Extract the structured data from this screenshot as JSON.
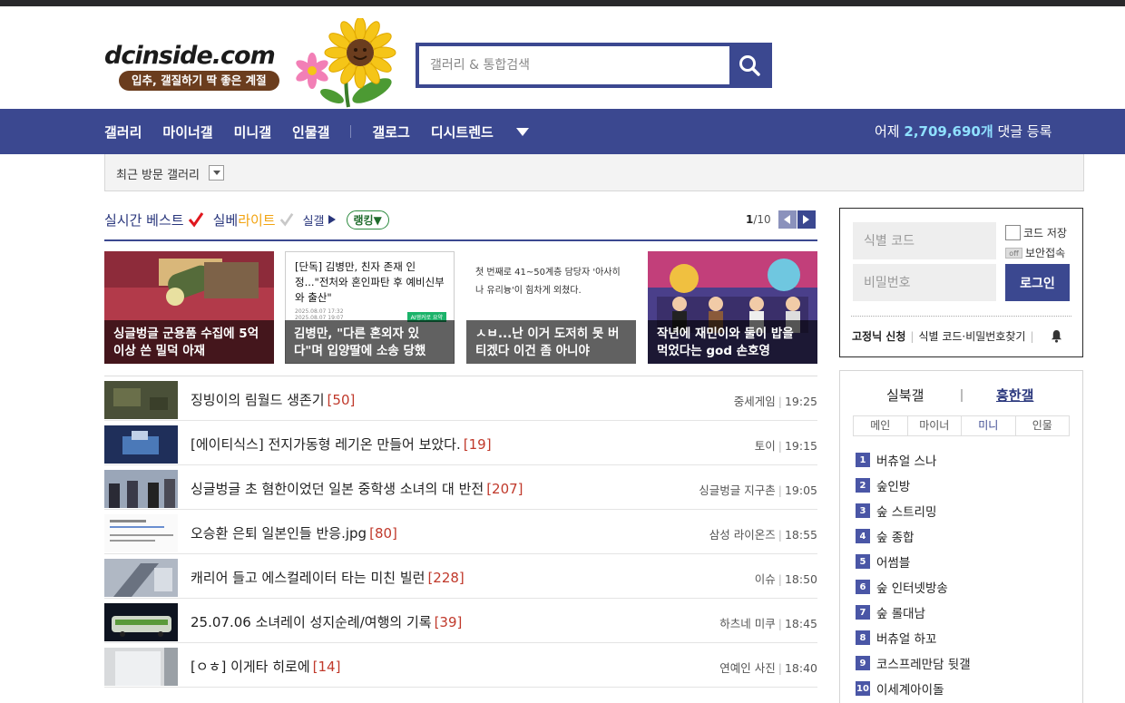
{
  "header": {
    "logo_text": "dcinside.com",
    "slogan": "입추, 갤질하기 딱 좋은 계절",
    "search_placeholder": "갤러리 & 통합검색"
  },
  "nav": {
    "items": [
      "갤러리",
      "마이너갤",
      "미니갤",
      "인물갤",
      "갤로그",
      "디시트렌드"
    ],
    "stat_prefix": "어제",
    "stat_number": "2,709,690개",
    "stat_suffix": "댓글 등록"
  },
  "recent": {
    "label": "최근 방문 갤러리"
  },
  "best": {
    "tab_realtime": "실시간 베스트",
    "tab_lite_prefix": "실베",
    "tab_lite_suffix": "라이트",
    "tab_silgal": "실갤",
    "ranking": "랭킹",
    "page_current": "1",
    "page_total": "/10"
  },
  "cards": [
    {
      "caption": "싱글벙글 군용품 수집에 5억 이상 쓴 밀덕 아재"
    },
    {
      "caption": "김병만, \"다른 혼외자 있다\"며 입양딸에 소송 당했",
      "inner_text": "[단독] 김병만, 친자 존재 인정...\"전처와 혼인파탄 후 예비신부와 출산\"",
      "inner_meta1": "2025.08.07 17:32",
      "inner_meta2": "2025.08.07 19:07",
      "inner_badge": "AI앵커로 요약"
    },
    {
      "caption": "ㅅㅂ...난 이거 도저히 못 버티겠다 이건 좀 아니야",
      "inner_text": "첫 번째로 41~50계층 담당자 '아사히나 유리늉'이 힘차게 외쳤다."
    },
    {
      "caption": "작년에 재민이와 둘이 밥을 먹었다는 god 손호영"
    }
  ],
  "posts": [
    {
      "title": "징빙이의 림월드 생존기",
      "count": "[50]",
      "gallery": "중세게임",
      "time": "19:25"
    },
    {
      "title": "[에이티식스] 전지가동형 레기온 만들어 보았다.",
      "count": "[19]",
      "gallery": "토이",
      "time": "19:15"
    },
    {
      "title": "싱글벙글 초 혐한이었던 일본 중학생 소녀의 대 반전",
      "count": "[207]",
      "gallery": "싱글벙글 지구촌",
      "time": "19:05"
    },
    {
      "title": "오승환 은퇴 일본인들 반응.jpg",
      "count": "[80]",
      "gallery": "삼성 라이온즈",
      "time": "18:55"
    },
    {
      "title": "캐리어 들고 에스컬레이터 타는 미친 빌런",
      "count": "[228]",
      "gallery": "이슈",
      "time": "18:50"
    },
    {
      "title": "25.07.06 소녀레이 성지순례/여행의 기록",
      "count": "[39]",
      "gallery": "하츠네 미쿠",
      "time": "18:45"
    },
    {
      "title": "[ㅇㅎ] 이게타 히로에",
      "count": "[14]",
      "gallery": "연예인 사진",
      "time": "18:40"
    }
  ],
  "login": {
    "id_placeholder": "식별 코드",
    "pw_placeholder": "비밀번호",
    "save_code": "코드 저장",
    "secure_off": "off",
    "secure": "보안접속",
    "login_button": "로그인",
    "signup": "고정닉 신청",
    "find": "식별 코드·비밀번호찾기"
  },
  "gallery_rank": {
    "tab1": "실북갤",
    "tab2": "흥한갤",
    "subtabs": [
      "메인",
      "마이너",
      "미니",
      "인물"
    ],
    "active_subtab": "미니",
    "items": [
      "버츄얼 스나",
      "숲인방",
      "숲 스트리밍",
      "숲 종합",
      "어썸블",
      "숲 인터넷방송",
      "숲 롤대남",
      "버츄얼 하꼬",
      "코스프레만담 뒷갤",
      "이세계아이돌"
    ]
  },
  "colors": {
    "brand": "#3b4890",
    "accent_stat": "#8fe0ff",
    "count_red": "#c0392b",
    "lite_orange": "#f2a30f"
  }
}
